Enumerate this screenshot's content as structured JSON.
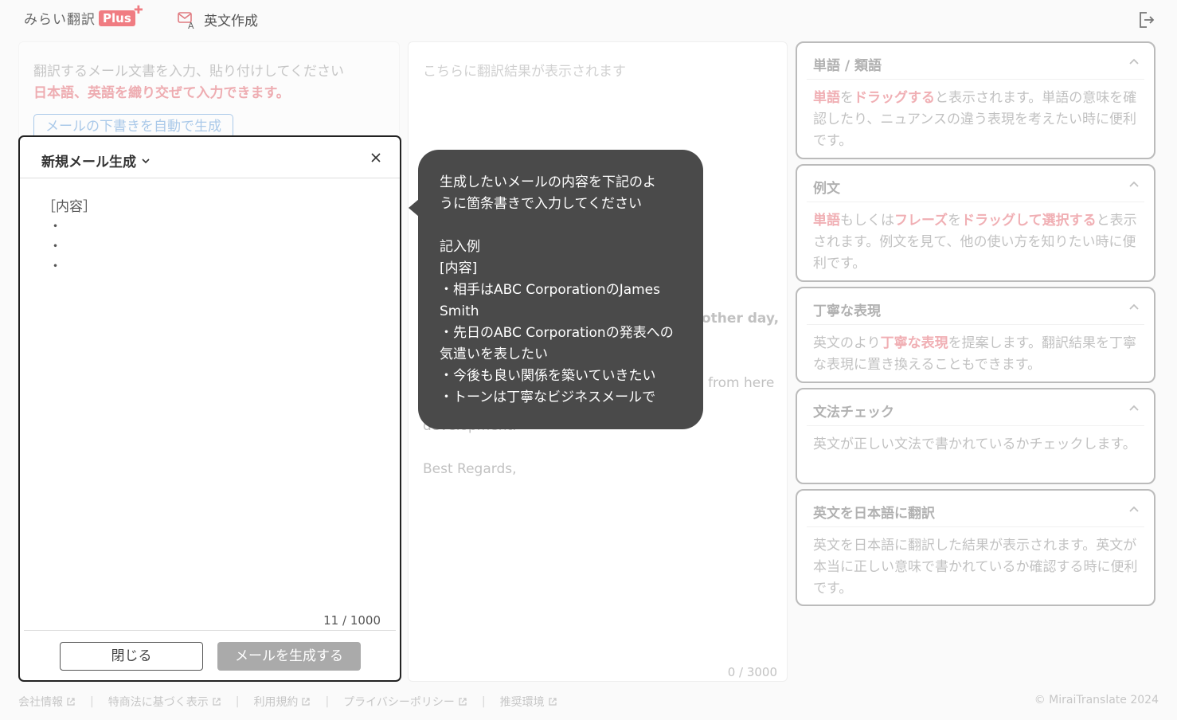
{
  "header": {
    "logo_text": "みらい翻訳",
    "logo_badge": "Plus",
    "mode_label": "英文作成"
  },
  "input_panel": {
    "placeholder_line1": "翻訳するメール文書を入力、貼り付けしてください",
    "placeholder_line2": "日本語、英語を織り交ぜて入力できます。",
    "draft_button": "メールの下書きを自動で生成"
  },
  "output_panel": {
    "placeholder": "こちらに翻訳結果が表示されます",
    "fragments": [
      "other day,",
      "from here",
      "development.",
      "Best Regards,"
    ],
    "counter": "0 / 3000"
  },
  "cards": [
    {
      "title": "単語 / 類語",
      "body": [
        {
          "t": "単語",
          "hl": true
        },
        {
          "t": "を",
          "hl": false
        },
        {
          "t": "ドラッグする",
          "hl": true
        },
        {
          "t": "と表示されます。単語の意味を確認したり、ニュアンスの違う表現を考えたい時に便利です。",
          "hl": false
        }
      ]
    },
    {
      "title": "例文",
      "body": [
        {
          "t": "単語",
          "hl": true
        },
        {
          "t": "もしくは",
          "hl": false
        },
        {
          "t": "フレーズ",
          "hl": true
        },
        {
          "t": "を",
          "hl": false
        },
        {
          "t": "ドラッグして選択する",
          "hl": true
        },
        {
          "t": "と表示されます。例文を見て、他の使い方を知りたい時に便利です。",
          "hl": false
        }
      ]
    },
    {
      "title": "丁寧な表現",
      "body": [
        {
          "t": "英文のより",
          "hl": false
        },
        {
          "t": "丁寧な表現",
          "hl": true
        },
        {
          "t": "を提案します。翻訳結果を丁寧な表現に置き換えることもできます。",
          "hl": false
        }
      ]
    },
    {
      "title": "文法チェック",
      "body": [
        {
          "t": "英文が正しい文法で書かれているかチェックします。",
          "hl": false
        }
      ]
    },
    {
      "title": "英文を日本語に翻訳",
      "body": [
        {
          "t": "英文を日本語に翻訳した結果が表示されます。英文が本当に正しい意味で書かれているか確認する時に便利です。",
          "hl": false
        }
      ]
    }
  ],
  "modal": {
    "title": "新規メール生成",
    "content_label": "［内容］",
    "bullets": [
      "・",
      "・",
      "・"
    ],
    "counter": "11 / 1000",
    "close_button": "閉じる",
    "generate_button": "メールを生成する"
  },
  "tooltip": {
    "lines": [
      "生成したいメールの内容を下記のよ",
      "うに箇条書きで入力してください",
      "",
      "記入例",
      "[内容]",
      "・相手はABC CorporationのJames",
      "Smith",
      "・先日のABC Corporationの発表への",
      "気遣いを表したい",
      "・今後も良い関係を築いていきたい",
      "・トーンは丁寧なビジネスメールで"
    ]
  },
  "footer": {
    "links": [
      "会社情報",
      "特商法に基づく表示",
      "利用規約",
      "プライバシーポリシー",
      "推奨環境"
    ],
    "copyright": "© MiraiTranslate 2024"
  },
  "colors": {
    "accent_red": "#e0505a",
    "accent_blue": "#4a8fd6",
    "tooltip_bg": "#4a4a4a"
  }
}
